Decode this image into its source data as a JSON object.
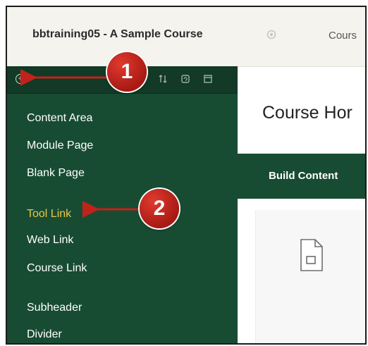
{
  "header": {
    "course_title": "bbtraining05 - A Sample Course",
    "breadcrumb": "Cours"
  },
  "sidebar": {
    "items": [
      {
        "label": "Content Area"
      },
      {
        "label": "Module Page"
      },
      {
        "label": "Blank Page"
      },
      {
        "label": "Tool Link",
        "active": true
      },
      {
        "label": "Web Link"
      },
      {
        "label": "Course Link"
      },
      {
        "label": "Subheader"
      },
      {
        "label": "Divider"
      }
    ]
  },
  "main": {
    "title": "Course Hor",
    "build_label": "Build Content"
  },
  "callouts": [
    "1",
    "2"
  ],
  "colors": {
    "sidebar_bg": "#184c32",
    "toolbar_bg": "#123a26",
    "active_item": "#e6c84a",
    "callout_red": "#c0231b"
  },
  "icons": [
    "add-icon",
    "sort-icon",
    "refresh-icon",
    "collapse-icon",
    "document-icon"
  ]
}
